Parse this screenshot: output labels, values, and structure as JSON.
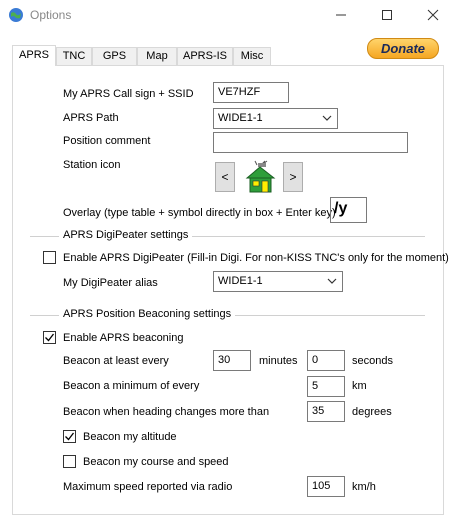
{
  "window": {
    "title": "Options",
    "controls": {
      "minimize": "—",
      "maximize": "☐",
      "close": "✕"
    }
  },
  "tabs": [
    {
      "label": "APRS",
      "active": true
    },
    {
      "label": "TNC"
    },
    {
      "label": "GPS"
    },
    {
      "label": "Map"
    },
    {
      "label": "APRS-IS"
    },
    {
      "label": "Misc"
    }
  ],
  "donate_label": "Donate",
  "aprs": {
    "callsign_label": "My APRS Call sign + SSID",
    "callsign_value": "VE7HZF",
    "path_label": "APRS Path",
    "path_value": "WIDE1-1",
    "comment_label": "Position comment",
    "comment_value": "",
    "station_icon_label": "Station icon",
    "prev_icon": "<",
    "next_icon": ">",
    "overlay_label": "Overlay (type table + symbol directly in box + Enter key)",
    "overlay_value": "/y"
  },
  "digipeater": {
    "group_title": "APRS DigiPeater settings",
    "enable_label": "Enable APRS DigiPeater (Fill-in Digi. For non-KISS TNC's only for the moment)",
    "enable_checked": false,
    "alias_label": "My DigiPeater alias",
    "alias_value": "WIDE1-1"
  },
  "beaconing": {
    "group_title": "APRS Position Beaconing settings",
    "enable_label": "Enable APRS beaconing",
    "enable_checked": true,
    "every_label": "Beacon at least every",
    "every_minutes": "30",
    "minutes_unit": "minutes",
    "every_seconds": "0",
    "seconds_unit": "seconds",
    "min_label": "Beacon a minimum of every",
    "min_value": "5",
    "min_unit": "km",
    "heading_label": "Beacon when heading changes more than",
    "heading_value": "35",
    "heading_unit": "degrees",
    "altitude_label": "Beacon my altitude",
    "altitude_checked": true,
    "course_label": "Beacon my course and speed",
    "course_checked": false,
    "maxspeed_label": "Maximum speed reported via radio",
    "maxspeed_value": "105",
    "maxspeed_unit": "km/h"
  },
  "colors": {
    "donate_top": "#ffd46b",
    "donate_bottom": "#f5a623",
    "house_green": "#2e9e3a",
    "house_yellow": "#ffee00"
  }
}
